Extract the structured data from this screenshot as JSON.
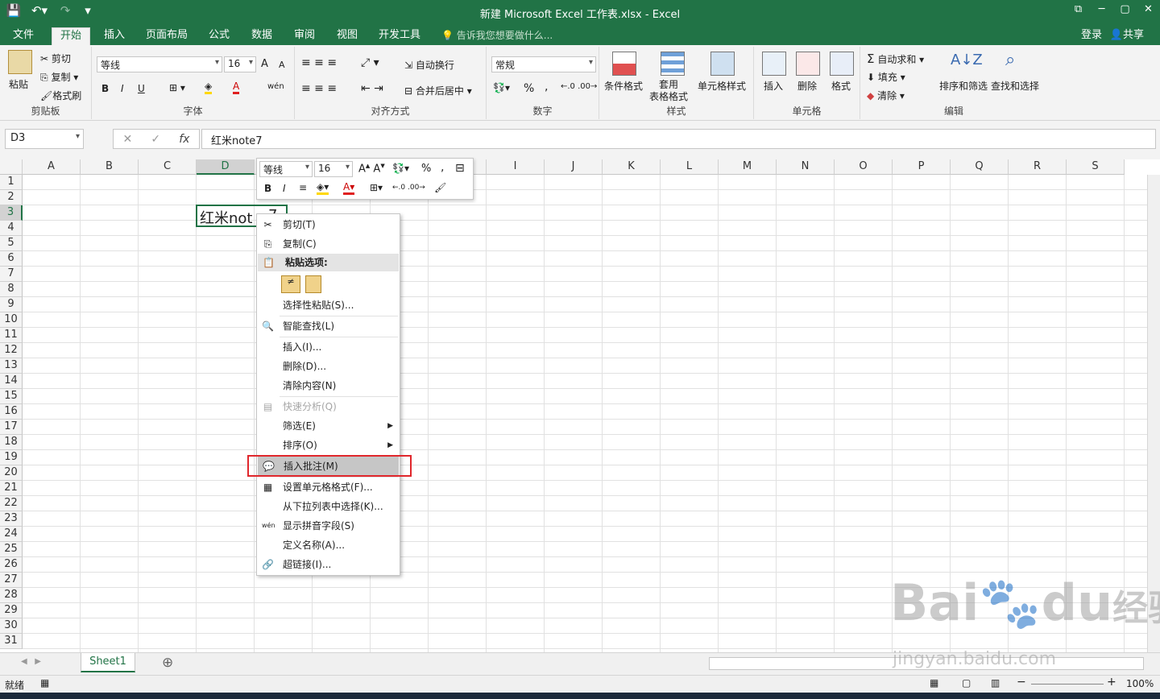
{
  "window": {
    "title": "新建 Microsoft Excel 工作表.xlsx - Excel",
    "controls": [
      "⧉",
      "─",
      "▢",
      "✕"
    ]
  },
  "qat": {
    "save": "💾",
    "undo": "↶▾",
    "redo": "↷",
    "customize": "▾"
  },
  "tabs": [
    "文件",
    "开始",
    "插入",
    "页面布局",
    "公式",
    "数据",
    "审阅",
    "视图",
    "开发工具"
  ],
  "active_tab": "开始",
  "tell_me": "告诉我您想要做什么...",
  "signin": "登录",
  "share": "共享",
  "ribbon": {
    "clipboard": {
      "label": "剪贴板",
      "paste": "粘贴",
      "cut": "剪切",
      "copy": "复制",
      "format_painter": "格式刷"
    },
    "font": {
      "label": "字体",
      "font_name": "等线",
      "font_size": "16",
      "bold": "B",
      "italic": "I",
      "underline": "U",
      "grow": "A",
      "shrink": "A",
      "phonetic": "wén"
    },
    "alignment": {
      "label": "对齐方式",
      "wrap": "自动换行",
      "merge": "合并后居中"
    },
    "number": {
      "label": "数字",
      "format": "常规",
      "percent": "%",
      "comma": ","
    },
    "styles": {
      "label": "样式",
      "conditional": "条件格式",
      "table": "套用\n表格格式",
      "cell_styles": "单元格样式"
    },
    "cells": {
      "label": "单元格",
      "insert": "插入",
      "delete": "删除",
      "format": "格式"
    },
    "editing": {
      "label": "编辑",
      "autosum": "自动求和",
      "fill": "填充",
      "clear": "清除",
      "sort": "排序和筛选",
      "find": "查找和选择"
    }
  },
  "formula_bar": {
    "name_box": "D3",
    "cancel": "✕",
    "enter": "✓",
    "fx": "fx",
    "content": "红米note7"
  },
  "columns": [
    "A",
    "B",
    "C",
    "D",
    "E",
    "F",
    "G",
    "H",
    "I",
    "J",
    "K",
    "L",
    "M",
    "N",
    "O",
    "P",
    "Q",
    "R",
    "S"
  ],
  "rows": [
    "1",
    "2",
    "3",
    "4",
    "5",
    "6",
    "7",
    "8",
    "9",
    "10",
    "11",
    "12",
    "13",
    "14",
    "15",
    "16",
    "17",
    "18",
    "19",
    "20",
    "21",
    "22",
    "23",
    "24",
    "25",
    "26",
    "27",
    "28",
    "29",
    "30",
    "31"
  ],
  "cell_D3": "红米not",
  "cell_D3_tail": "7",
  "mini_toolbar": {
    "font": "等线",
    "size": "16",
    "bold": "B",
    "italic": "I",
    "percent": "%",
    "comma": ","
  },
  "context_menu": {
    "cut": "剪切(T)",
    "copy": "复制(C)",
    "paste_options": "粘贴选项:",
    "paste_special": "选择性粘贴(S)...",
    "smart_lookup": "智能查找(L)",
    "insert": "插入(I)...",
    "delete": "删除(D)...",
    "clear": "清除内容(N)",
    "quick_analysis": "快速分析(Q)",
    "filter": "筛选(E)",
    "sort": "排序(O)",
    "insert_comment": "插入批注(M)",
    "format_cells": "设置单元格格式(F)...",
    "pick_list": "从下拉列表中选择(K)...",
    "phonetic": "显示拼音字段(S)",
    "define_name": "定义名称(A)...",
    "hyperlink": "超链接(I)..."
  },
  "sheet_tab": "Sheet1",
  "add_sheet": "⊕",
  "status": {
    "ready": "就绪",
    "zoom": "100%"
  },
  "watermark": {
    "brand": "Bai",
    "paw": "du",
    "cn": "经验",
    "url": "jingyan.baidu.com"
  },
  "colors": {
    "accent": "#217346",
    "highlight_box": "#e0272c"
  }
}
